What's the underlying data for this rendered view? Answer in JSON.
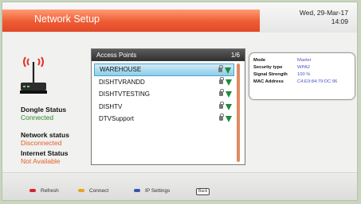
{
  "header": {
    "title": "Network Setup",
    "date": "Wed, 29-Mar-17",
    "time": "14:09"
  },
  "status": {
    "dongle_label": "Dongle Status",
    "dongle_value": "Connected",
    "network_label": "Network status",
    "network_value": "Disconnected",
    "internet_label": "Internet Status",
    "internet_value": "Not Available"
  },
  "access_points": {
    "title": "Access Points",
    "page": "1/6",
    "items": [
      {
        "ssid": "WAREHOUSE",
        "selected": true
      },
      {
        "ssid": "DISHTVRANDD",
        "selected": false
      },
      {
        "ssid": "DISHTVTESTING",
        "selected": false
      },
      {
        "ssid": "DISHTV",
        "selected": false
      },
      {
        "ssid": "DTVSupport",
        "selected": false
      }
    ]
  },
  "details": {
    "mode_label": "Mode",
    "mode_value": "Master",
    "security_label": "Security type",
    "security_value": "WPA2",
    "signal_label": "Signal Strength",
    "signal_value": "100 %",
    "mac_label": "MAC Address",
    "mac_value": "C4:E9:84:79:DC:96"
  },
  "footer": {
    "refresh_label": "Refresh",
    "connect_label": "Connect",
    "ip_settings_label": "IP Settings",
    "back_label": "Back"
  },
  "colors": {
    "refresh": "#d8232a",
    "connect": "#e8a41d",
    "ip_settings": "#3556b0",
    "accent": "#ee5c33"
  }
}
